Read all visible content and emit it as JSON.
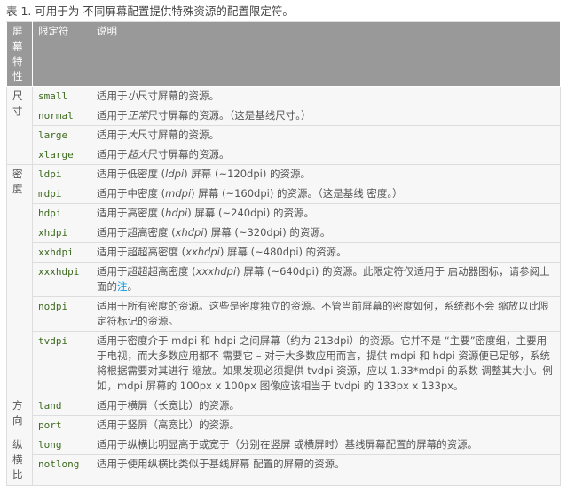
{
  "caption": "表 1. 可用于为 不同屏幕配置提供特殊资源的配置限定符。",
  "headers": {
    "feature": "屏幕特性",
    "qualifier": "限定符",
    "desc": "说明"
  },
  "groups": {
    "size": "尺寸",
    "density": "密度",
    "orientation": "方向",
    "aspect": "纵横比"
  },
  "rows": {
    "small": {
      "q": "small",
      "a": "适用于",
      "e": "小",
      "b": "尺寸屏幕的资源。"
    },
    "normal": {
      "q": "normal",
      "a": "适用于",
      "e": "正常",
      "b": "尺寸屏幕的资源。（这是基线尺寸。）"
    },
    "large": {
      "q": "large",
      "a": "适用于",
      "e": "大",
      "b": "尺寸屏幕的资源。"
    },
    "xlarge": {
      "q": "xlarge",
      "a": "适用于",
      "e": "超大",
      "b": "尺寸屏幕的资源。"
    },
    "ldpi": {
      "q": "ldpi",
      "a": "适用于低密度 (",
      "e": "ldpi",
      "b": ") 屏幕 (~120dpi) 的资源。"
    },
    "mdpi": {
      "q": "mdpi",
      "a": "适用于中密度 (",
      "e": "mdpi",
      "b": ") 屏幕 (~160dpi) 的资源。（这是基线 密度。）"
    },
    "hdpi": {
      "q": "hdpi",
      "a": "适用于高密度 (",
      "e": "hdpi",
      "b": ") 屏幕 (~240dpi) 的资源。"
    },
    "xhdpi": {
      "q": "xhdpi",
      "a": "适用于超高密度 (",
      "e": "xhdpi",
      "b": ") 屏幕 (~320dpi) 的资源。"
    },
    "xxhdpi": {
      "q": "xxhdpi",
      "a": "适用于超超高密度 (",
      "e": "xxhdpi",
      "b": ") 屏幕 (~480dpi) 的资源。"
    },
    "xxxhdpi": {
      "q": "xxxhdpi",
      "a": "适用于超超超高密度 (",
      "e": "xxxhdpi",
      "b": ") 屏幕 (~640dpi) 的资源。此限定符仅适用于 启动器图标，请参阅上面的",
      "link": "注",
      "c": "。"
    },
    "nodpi": {
      "q": "nodpi",
      "a": "适用于所有密度的资源。这些是密度独立的资源。不管当前屏幕的密度如何，系统都不会 缩放以此限定符标记的资源。"
    },
    "tvdpi": {
      "q": "tvdpi",
      "a": "适用于密度介于 mdpi 和 hdpi 之间屏幕（约为 213dpi）的资源。它并不是 “主要”密度组，主要用于电视，而大多数应用都不 需要它 – 对于大多数应用而言，提供 mdpi 和 hdpi 资源便已足够，系统将根据需要对其进行 缩放。如果发现必须提供 tvdpi 资源，应以 1.33*mdpi 的系数 调整其大小。例如，mdpi 屏幕的 100px x 100px 图像应该相当于 tvdpi 的 133px x 133px。"
    },
    "land": {
      "q": "land",
      "a": "适用于横屏（长宽比）的资源。"
    },
    "port": {
      "q": "port",
      "a": "适用于竖屏（高宽比）的资源。"
    },
    "long": {
      "q": "long",
      "a": "适用于纵横比明显高于或宽于（分别在竖屏 或横屏时）基线屏幕配置的屏幕的资源。"
    },
    "notlong": {
      "q": "notlong",
      "a": "适用于使用纵横比类似于基线屏幕 配置的屏幕的资源。"
    }
  }
}
